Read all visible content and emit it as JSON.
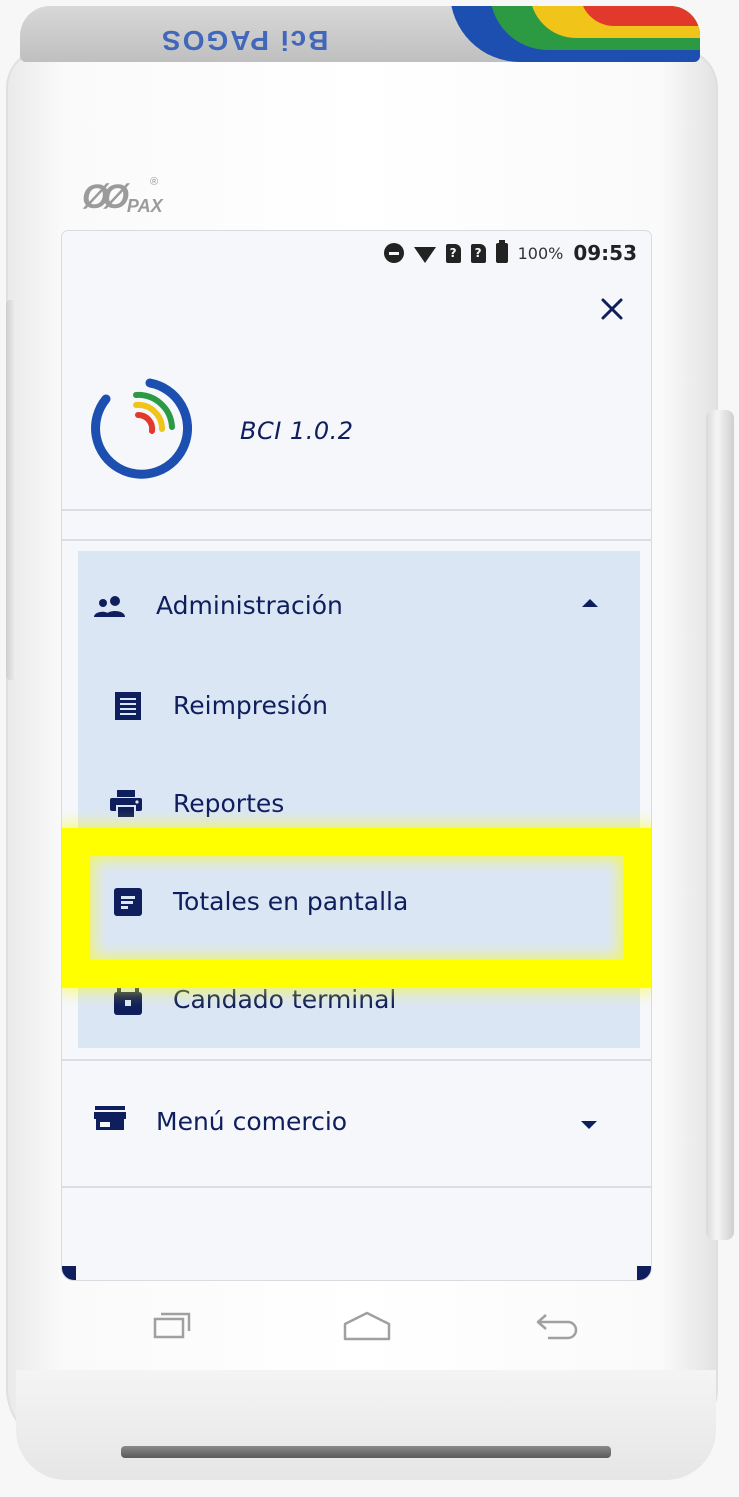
{
  "device": {
    "brand_top": "Bci PAGOS",
    "maker": "PAX",
    "maker_mark": "®"
  },
  "statusbar": {
    "battery_pct": "100%",
    "time": "09:53",
    "sim1": "?",
    "sim2": "?"
  },
  "app": {
    "version": "BCI 1.0.2"
  },
  "nav": {
    "admin_label": "Administración",
    "items": [
      {
        "label": "Reimpresión",
        "icon": "receipt-icon"
      },
      {
        "label": "Reportes",
        "icon": "printer-icon"
      },
      {
        "label": "Totales en pantalla",
        "icon": "summary-icon"
      },
      {
        "label": "Candado terminal",
        "icon": "lock-icon"
      }
    ],
    "comercio_label": "Menú comercio"
  },
  "colors": {
    "navy": "#0f1e5c",
    "panel": "#dbe6f5",
    "highlight": "#ffff00",
    "logo_blue": "#1c4fb0",
    "logo_green": "#2b9a43",
    "logo_yellow": "#f0c419",
    "logo_red": "#e2392d"
  }
}
